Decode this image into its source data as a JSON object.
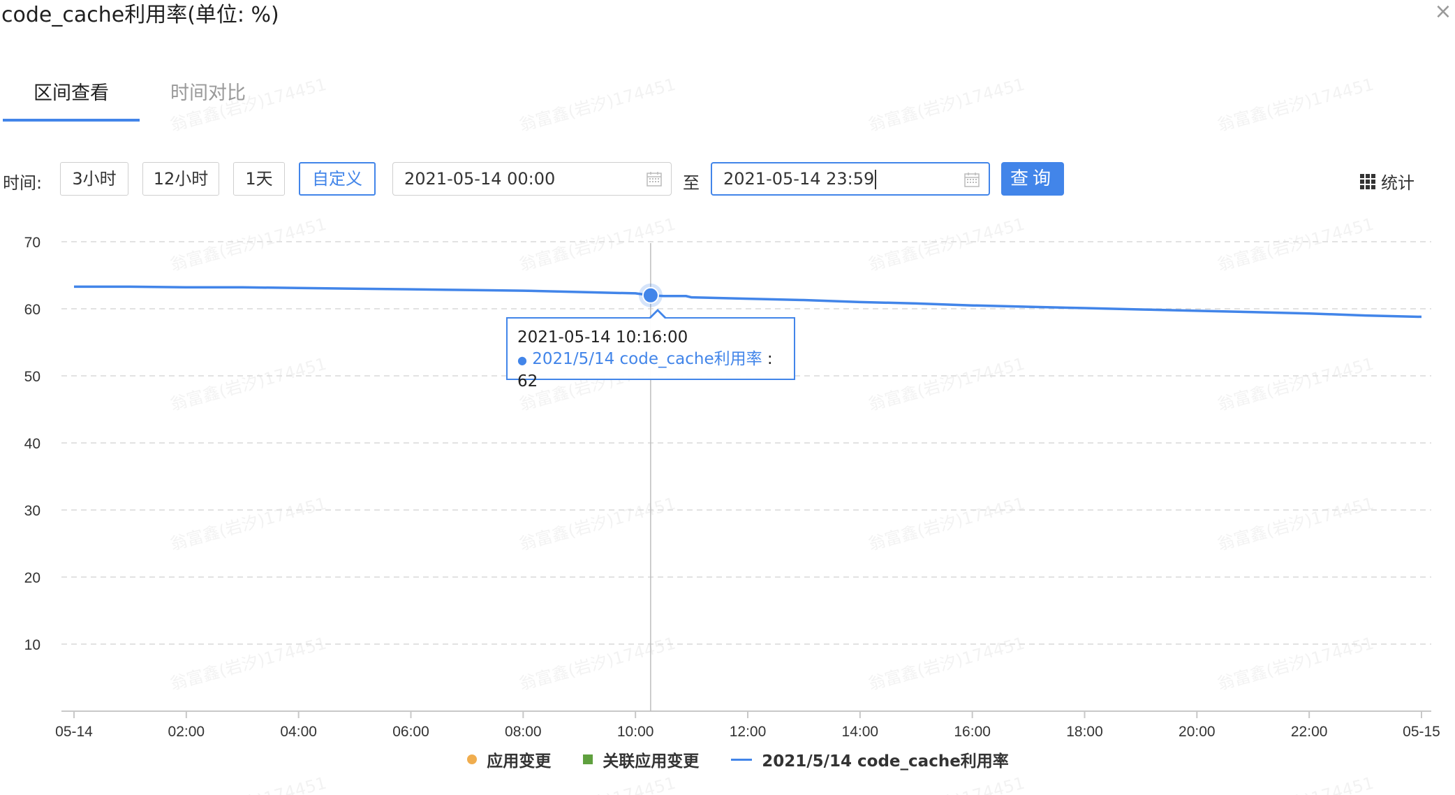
{
  "title": "code_cache利用率(单位: %)",
  "close_glyph": "×",
  "tabs": [
    {
      "label": "区间查看",
      "active": true
    },
    {
      "label": "时间对比",
      "active": false
    }
  ],
  "controls": {
    "time_label": "时间:",
    "ranges": [
      {
        "label": "3小时",
        "active": false
      },
      {
        "label": "12小时",
        "active": false
      },
      {
        "label": "1天",
        "active": false
      },
      {
        "label": "自定义",
        "active": true
      }
    ],
    "start_date": "2021-05-14 00:00",
    "to_label": "至",
    "end_date": "2021-05-14 23:59",
    "query_label": "查询",
    "stats_label": "统计"
  },
  "watermark": "翁富鑫(岩汐)174451",
  "tooltip": {
    "time": "2021-05-14 10:16:00",
    "series_label": "2021/5/14 code_cache利用率",
    "value_text": ": 62"
  },
  "legend": [
    {
      "label": "应用变更",
      "marker": "dot",
      "color": "#f0ad4e"
    },
    {
      "label": "关联应用变更",
      "marker": "square",
      "color": "#5fa03e"
    },
    {
      "label": "2021/5/14 code_cache利用率",
      "marker": "line",
      "color": "#4285e9"
    }
  ],
  "colors": {
    "accent": "#4285e9",
    "grid": "#d9d9d9",
    "axis_text": "#333333"
  },
  "chart_data": {
    "type": "line",
    "title": "",
    "xlabel": "",
    "ylabel": "",
    "ylim": [
      0,
      70
    ],
    "yticks": [
      10,
      20,
      30,
      40,
      50,
      60,
      70
    ],
    "xlim": [
      0,
      24
    ],
    "xticks": [
      {
        "x": 0,
        "label": "05-14"
      },
      {
        "x": 2,
        "label": "02:00"
      },
      {
        "x": 4,
        "label": "04:00"
      },
      {
        "x": 6,
        "label": "06:00"
      },
      {
        "x": 8,
        "label": "08:00"
      },
      {
        "x": 10,
        "label": "10:00"
      },
      {
        "x": 12,
        "label": "12:00"
      },
      {
        "x": 14,
        "label": "14:00"
      },
      {
        "x": 16,
        "label": "16:00"
      },
      {
        "x": 18,
        "label": "18:00"
      },
      {
        "x": 20,
        "label": "20:00"
      },
      {
        "x": 22,
        "label": "22:00"
      },
      {
        "x": 24,
        "label": "05-15"
      }
    ],
    "series": [
      {
        "name": "2021/5/14 code_cache利用率",
        "color": "#4285e9",
        "x": [
          0,
          1,
          2,
          3,
          4,
          5,
          6,
          7,
          8,
          9,
          10,
          10.27,
          10.5,
          10.9,
          11,
          12,
          13,
          14,
          15,
          16,
          17,
          18,
          19,
          20,
          21,
          22,
          23,
          24
        ],
        "y": [
          63.3,
          63.3,
          63.2,
          63.2,
          63.1,
          63.0,
          62.9,
          62.8,
          62.7,
          62.5,
          62.3,
          62.0,
          61.9,
          61.9,
          61.7,
          61.5,
          61.3,
          61.0,
          60.8,
          60.5,
          60.3,
          60.1,
          59.9,
          59.7,
          59.5,
          59.3,
          59.0,
          58.8
        ]
      }
    ],
    "hover": {
      "x": 10.27,
      "y": 62
    },
    "grid": true,
    "legend_position": "bottom"
  }
}
